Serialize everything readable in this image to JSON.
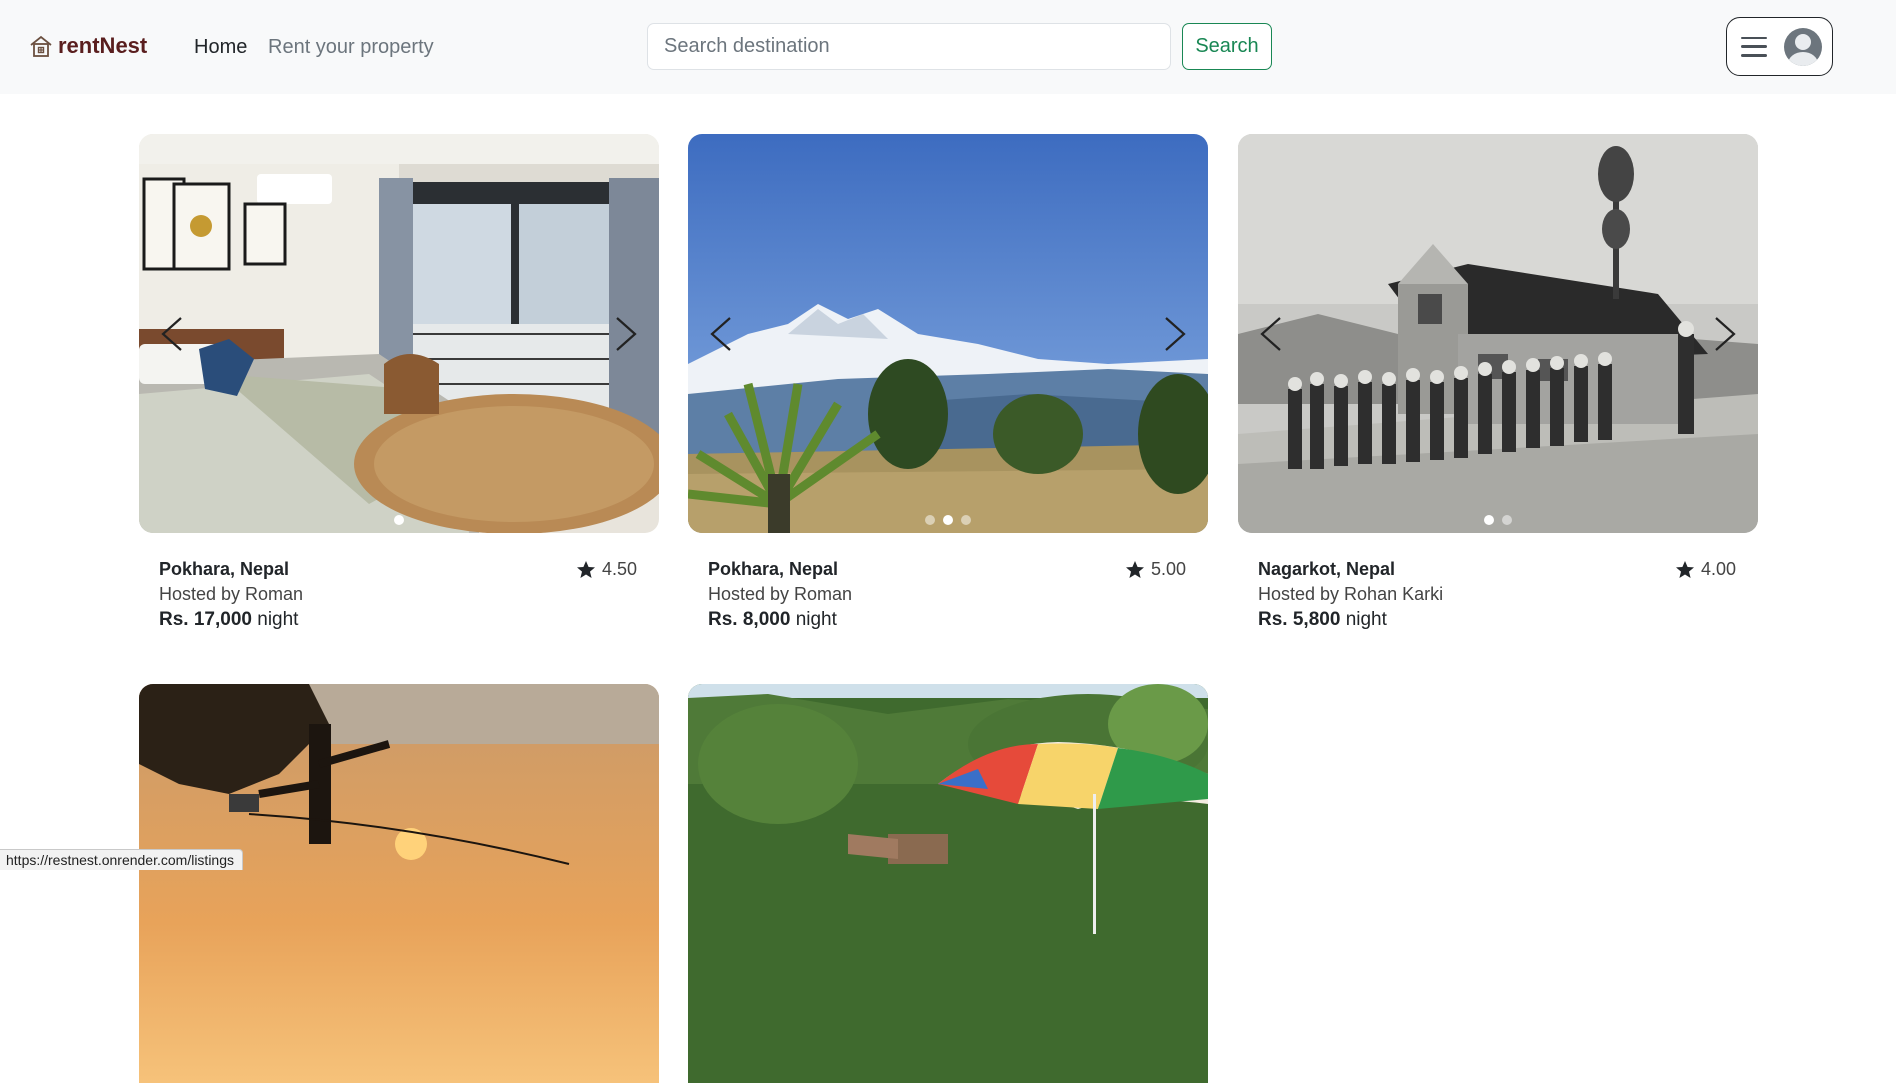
{
  "header": {
    "brand": "rentNest",
    "nav": {
      "home": "Home",
      "rent": "Rent your property"
    },
    "search": {
      "placeholder": "Search destination",
      "button": "Search"
    }
  },
  "listings": [
    {
      "location": "Pokhara, Nepal",
      "host": "Hosted by Roman",
      "price": "Rs. 17,000",
      "unit": "night",
      "rating": "4.50"
    },
    {
      "location": "Pokhara, Nepal",
      "host": "Hosted by Roman",
      "price": "Rs. 8,000",
      "unit": "night",
      "rating": "5.00"
    },
    {
      "location": "Nagarkot, Nepal",
      "host": "Hosted by Rohan Karki",
      "price": "Rs. 5,800",
      "unit": "night",
      "rating": "4.00"
    }
  ],
  "status_bar": {
    "url": "https://restnest.onrender.com/listings"
  },
  "colors": {
    "brand": "#5a1e1e",
    "search_button": "#198754",
    "navbar_bg": "#f8f9fa"
  },
  "icons": {
    "brand": "house-icon",
    "menu": "hamburger-icon",
    "user": "avatar-icon",
    "rating": "star-icon",
    "carousel_prev": "chevron-left-icon",
    "carousel_next": "chevron-right-icon"
  }
}
